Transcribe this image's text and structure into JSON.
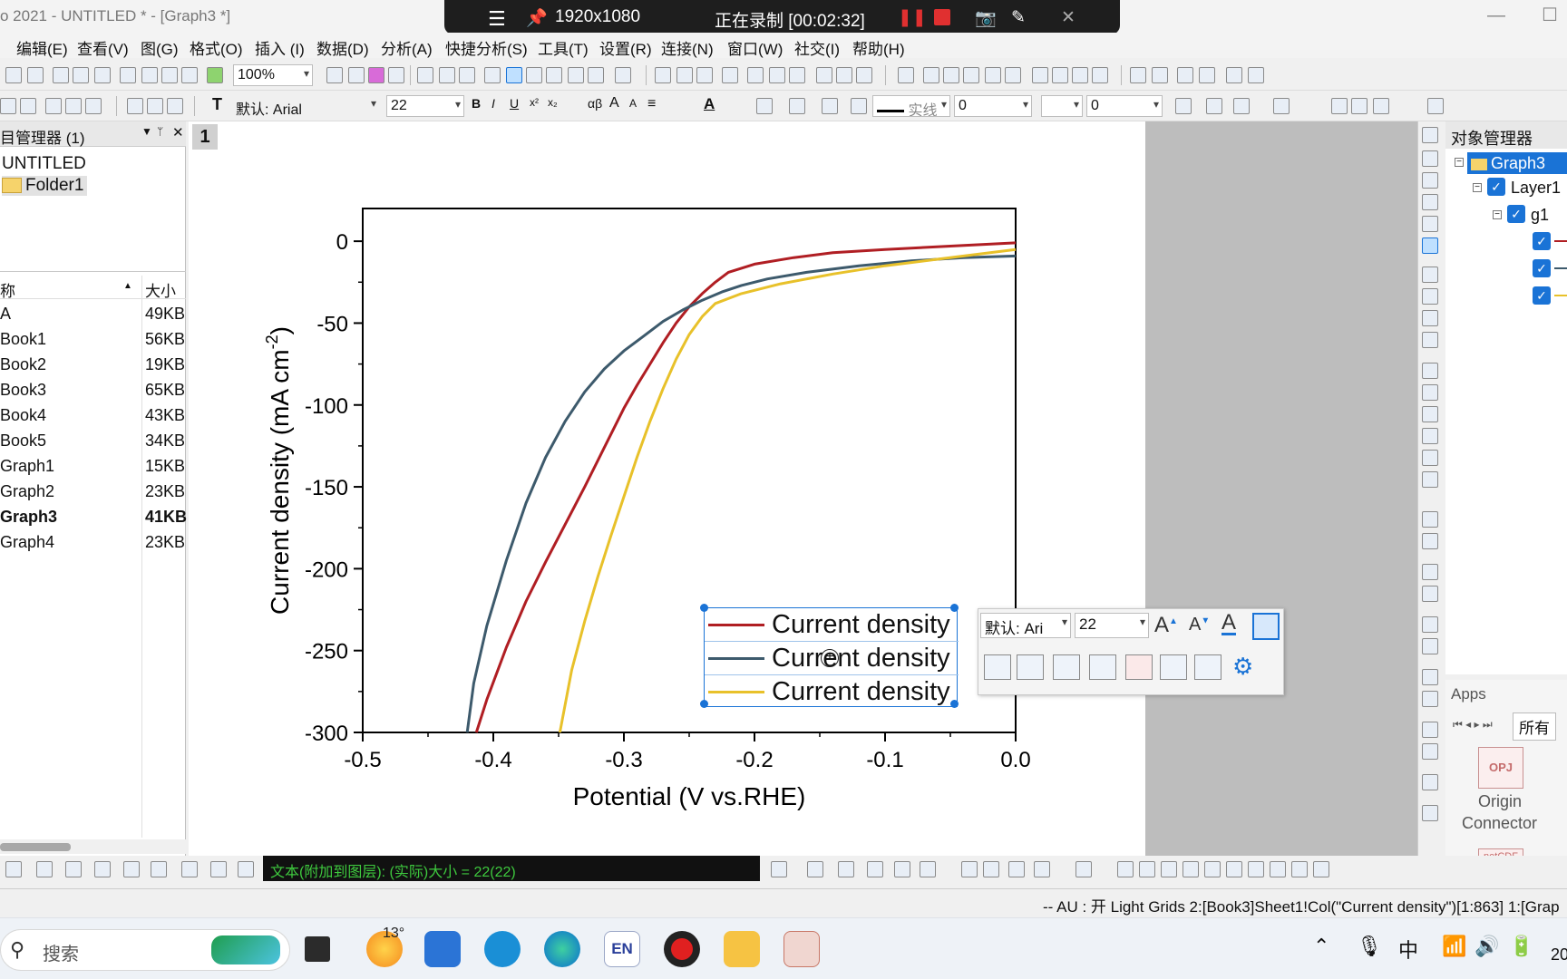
{
  "window": {
    "title": "o 2021 - UNTITLED * - [Graph3 *]"
  },
  "recorder": {
    "resolution": "1920x1080",
    "status": "正在录制 [00:02:32]"
  },
  "menu": [
    "编辑(E)",
    "查看(V)",
    "图(G)",
    "格式(O)",
    "插入 (I)",
    "数据(D)",
    "分析(A)",
    "快捷分析(S)",
    "工具(T)",
    "设置(R)",
    "连接(N)",
    "窗口(W)",
    "社交(I)",
    "帮助(H)"
  ],
  "toolbar": {
    "zoom": "100%",
    "font": "默认: Arial",
    "font_size": "22",
    "line_style": "实线",
    "line_width": "0",
    "pattern_value": "0"
  },
  "project_explorer": {
    "title": "目管理器 (1)",
    "tree": [
      "UNTITLED",
      "Folder1"
    ],
    "columns": [
      "称",
      "大小"
    ],
    "files": [
      {
        "name": "A",
        "size": "49KB"
      },
      {
        "name": "Book1",
        "size": "56KB"
      },
      {
        "name": "Book2",
        "size": "19KB"
      },
      {
        "name": "Book3",
        "size": "65KB"
      },
      {
        "name": "Book4",
        "size": "43KB"
      },
      {
        "name": "Book5",
        "size": "34KB"
      },
      {
        "name": "Graph1",
        "size": "15KB"
      },
      {
        "name": "Graph2",
        "size": "23KB"
      },
      {
        "name": "Graph3",
        "size": "41KB",
        "bold": true
      },
      {
        "name": "Graph4",
        "size": "23KB"
      }
    ]
  },
  "graph": {
    "page_number": "1"
  },
  "chart_data": {
    "type": "line",
    "title": "",
    "xlabel": "Potential (V vs.RHE)",
    "ylabel_main": "Current density (mA cm",
    "ylabel_sup": "-2",
    "ylabel_close": ")",
    "xlim": [
      -0.5,
      0.0
    ],
    "ylim": [
      -300,
      20
    ],
    "xticks": [
      "-0.5",
      "-0.4",
      "-0.3",
      "-0.2",
      "-0.1",
      "0.0"
    ],
    "xtick_values": [
      -0.5,
      -0.4,
      -0.3,
      -0.2,
      -0.1,
      0.0
    ],
    "yticks": [
      "0",
      "-50",
      "-100",
      "-150",
      "-200",
      "-250",
      "-300"
    ],
    "ytick_values": [
      0,
      -50,
      -100,
      -150,
      -200,
      -250,
      -300
    ],
    "series": [
      {
        "name": "Current density",
        "color": "#b01e23",
        "x": [
          -0.413,
          -0.405,
          -0.39,
          -0.375,
          -0.36,
          -0.345,
          -0.33,
          -0.315,
          -0.3,
          -0.29,
          -0.28,
          -0.27,
          -0.26,
          -0.25,
          -0.24,
          -0.23,
          -0.22,
          -0.2,
          -0.17,
          -0.14,
          -0.1,
          -0.05,
          0.0
        ],
        "y": [
          -300,
          -280,
          -248,
          -220,
          -196,
          -173,
          -150,
          -126,
          -102,
          -88,
          -75,
          -62,
          -50,
          -40,
          -32,
          -25,
          -19,
          -14,
          -10,
          -7,
          -5,
          -3,
          -1
        ]
      },
      {
        "name": "Current density",
        "color": "#3d5a6c",
        "x": [
          -0.42,
          -0.415,
          -0.405,
          -0.39,
          -0.375,
          -0.36,
          -0.345,
          -0.33,
          -0.315,
          -0.3,
          -0.285,
          -0.27,
          -0.255,
          -0.24,
          -0.225,
          -0.21,
          -0.19,
          -0.16,
          -0.12,
          -0.08,
          -0.04,
          0.0
        ],
        "y": [
          -300,
          -270,
          -235,
          -195,
          -160,
          -132,
          -110,
          -92,
          -78,
          -67,
          -58,
          -49,
          -42,
          -36,
          -31,
          -27,
          -23,
          -19,
          -15,
          -12,
          -10,
          -9
        ]
      },
      {
        "name": "Current density",
        "color": "#e8c12a",
        "x": [
          -0.349,
          -0.34,
          -0.33,
          -0.32,
          -0.31,
          -0.3,
          -0.29,
          -0.28,
          -0.27,
          -0.26,
          -0.25,
          -0.24,
          -0.23,
          -0.21,
          -0.18,
          -0.14,
          -0.1,
          -0.06,
          -0.03,
          0.0
        ],
        "y": [
          -300,
          -262,
          -232,
          -205,
          -180,
          -156,
          -132,
          -110,
          -90,
          -72,
          -57,
          -46,
          -38,
          -32,
          -26,
          -20,
          -15,
          -11,
          -8,
          -5
        ]
      }
    ]
  },
  "mini_toolbar": {
    "font": "默认: Ari",
    "size": "22"
  },
  "object_manager": {
    "title": "对象管理器",
    "items": [
      "Graph3",
      "Layer1",
      "g1"
    ]
  },
  "apps_panel": {
    "title": "Apps",
    "tab": "所有",
    "app_name_line1": "Origin",
    "app_name_line2": "Connector",
    "app_icon_label": "OPJ",
    "app2_icon_label": "netCDF"
  },
  "status_green": "文本(附加到图层): (实际)大小 = 22(22)",
  "status_bar": "--   AU : 开  Light Grids  2:[Book3]Sheet1!Col(\"Current density\")[1:863]  1:[Grap",
  "taskbar": {
    "search_placeholder": "搜索",
    "weather": "13°",
    "ime_lang": "EN",
    "ime_cn": "中",
    "clock_partial": "20"
  },
  "colors": {
    "accent_selection": "#1a73d6",
    "status_green_text": "#3ec93e"
  }
}
